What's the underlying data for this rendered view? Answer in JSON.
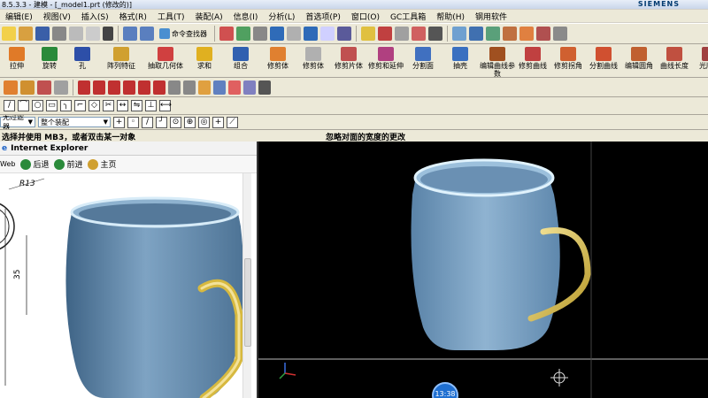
{
  "titlebar": {
    "title": "8.5.3.3 - 建模 - [_model1.prt (修改的)]",
    "brand": "SIEMENS"
  },
  "menu": [
    "编辑(E)",
    "视图(V)",
    "插入(S)",
    "格式(R)",
    "工具(T)",
    "装配(A)",
    "信息(I)",
    "分析(L)",
    "首选项(P)",
    "窗口(O)",
    "GC工具箱",
    "帮助(H)",
    "钢用软件"
  ],
  "toolbar1": {
    "command_finder": "命令查找器"
  },
  "ribbon": [
    {
      "label": "拉伸",
      "color": "#e07a28"
    },
    {
      "label": "旋转",
      "color": "#2a8a3a"
    },
    {
      "label": "孔",
      "color": "#2d4fa8"
    },
    {
      "label": "阵列特征",
      "color": "#d0a030"
    },
    {
      "label": "抽取几何体",
      "color": "#d04040"
    },
    {
      "label": "求和",
      "color": "#e0b020"
    },
    {
      "label": "组合",
      "color": "#3060b0"
    },
    {
      "label": "修剪体",
      "color": "#e08030"
    },
    {
      "label": "修剪体",
      "color": "#b0b0b0"
    },
    {
      "label": "修剪片体",
      "color": "#c05050"
    },
    {
      "label": "修剪和延伸",
      "color": "#b04080"
    },
    {
      "label": "分割面",
      "color": "#4070c0"
    },
    {
      "label": "抽壳",
      "color": "#3a70c0"
    },
    {
      "label": "编辑曲线参数",
      "color": "#a05020"
    },
    {
      "label": "修剪曲线",
      "color": "#c04040"
    },
    {
      "label": "修剪拐角",
      "color": "#d06030"
    },
    {
      "label": "分割曲线",
      "color": "#d05030"
    },
    {
      "label": "编辑圆角",
      "color": "#c06030"
    },
    {
      "label": "曲线长度",
      "color": "#c05040"
    },
    {
      "label": "光顺样",
      "color": "#a04040"
    }
  ],
  "toolbar3": {
    "filter": "无过滤器",
    "assembly": "整个装配"
  },
  "status": {
    "prompt": "选择并使用 MB3，或者双击某一对象",
    "message": "忽略对面的宽度的更改"
  },
  "browser": {
    "title": "Internet Explorer",
    "back": "后退",
    "forward": "前进",
    "home": "主页",
    "dim_r": "R13",
    "dim_35": "35"
  },
  "clock": "13:38",
  "colors": {
    "cup_body": "#6f97b9",
    "handle": "#e2c75a",
    "viewport_bg": "#000000",
    "ui_bg": "#ece9d8"
  }
}
